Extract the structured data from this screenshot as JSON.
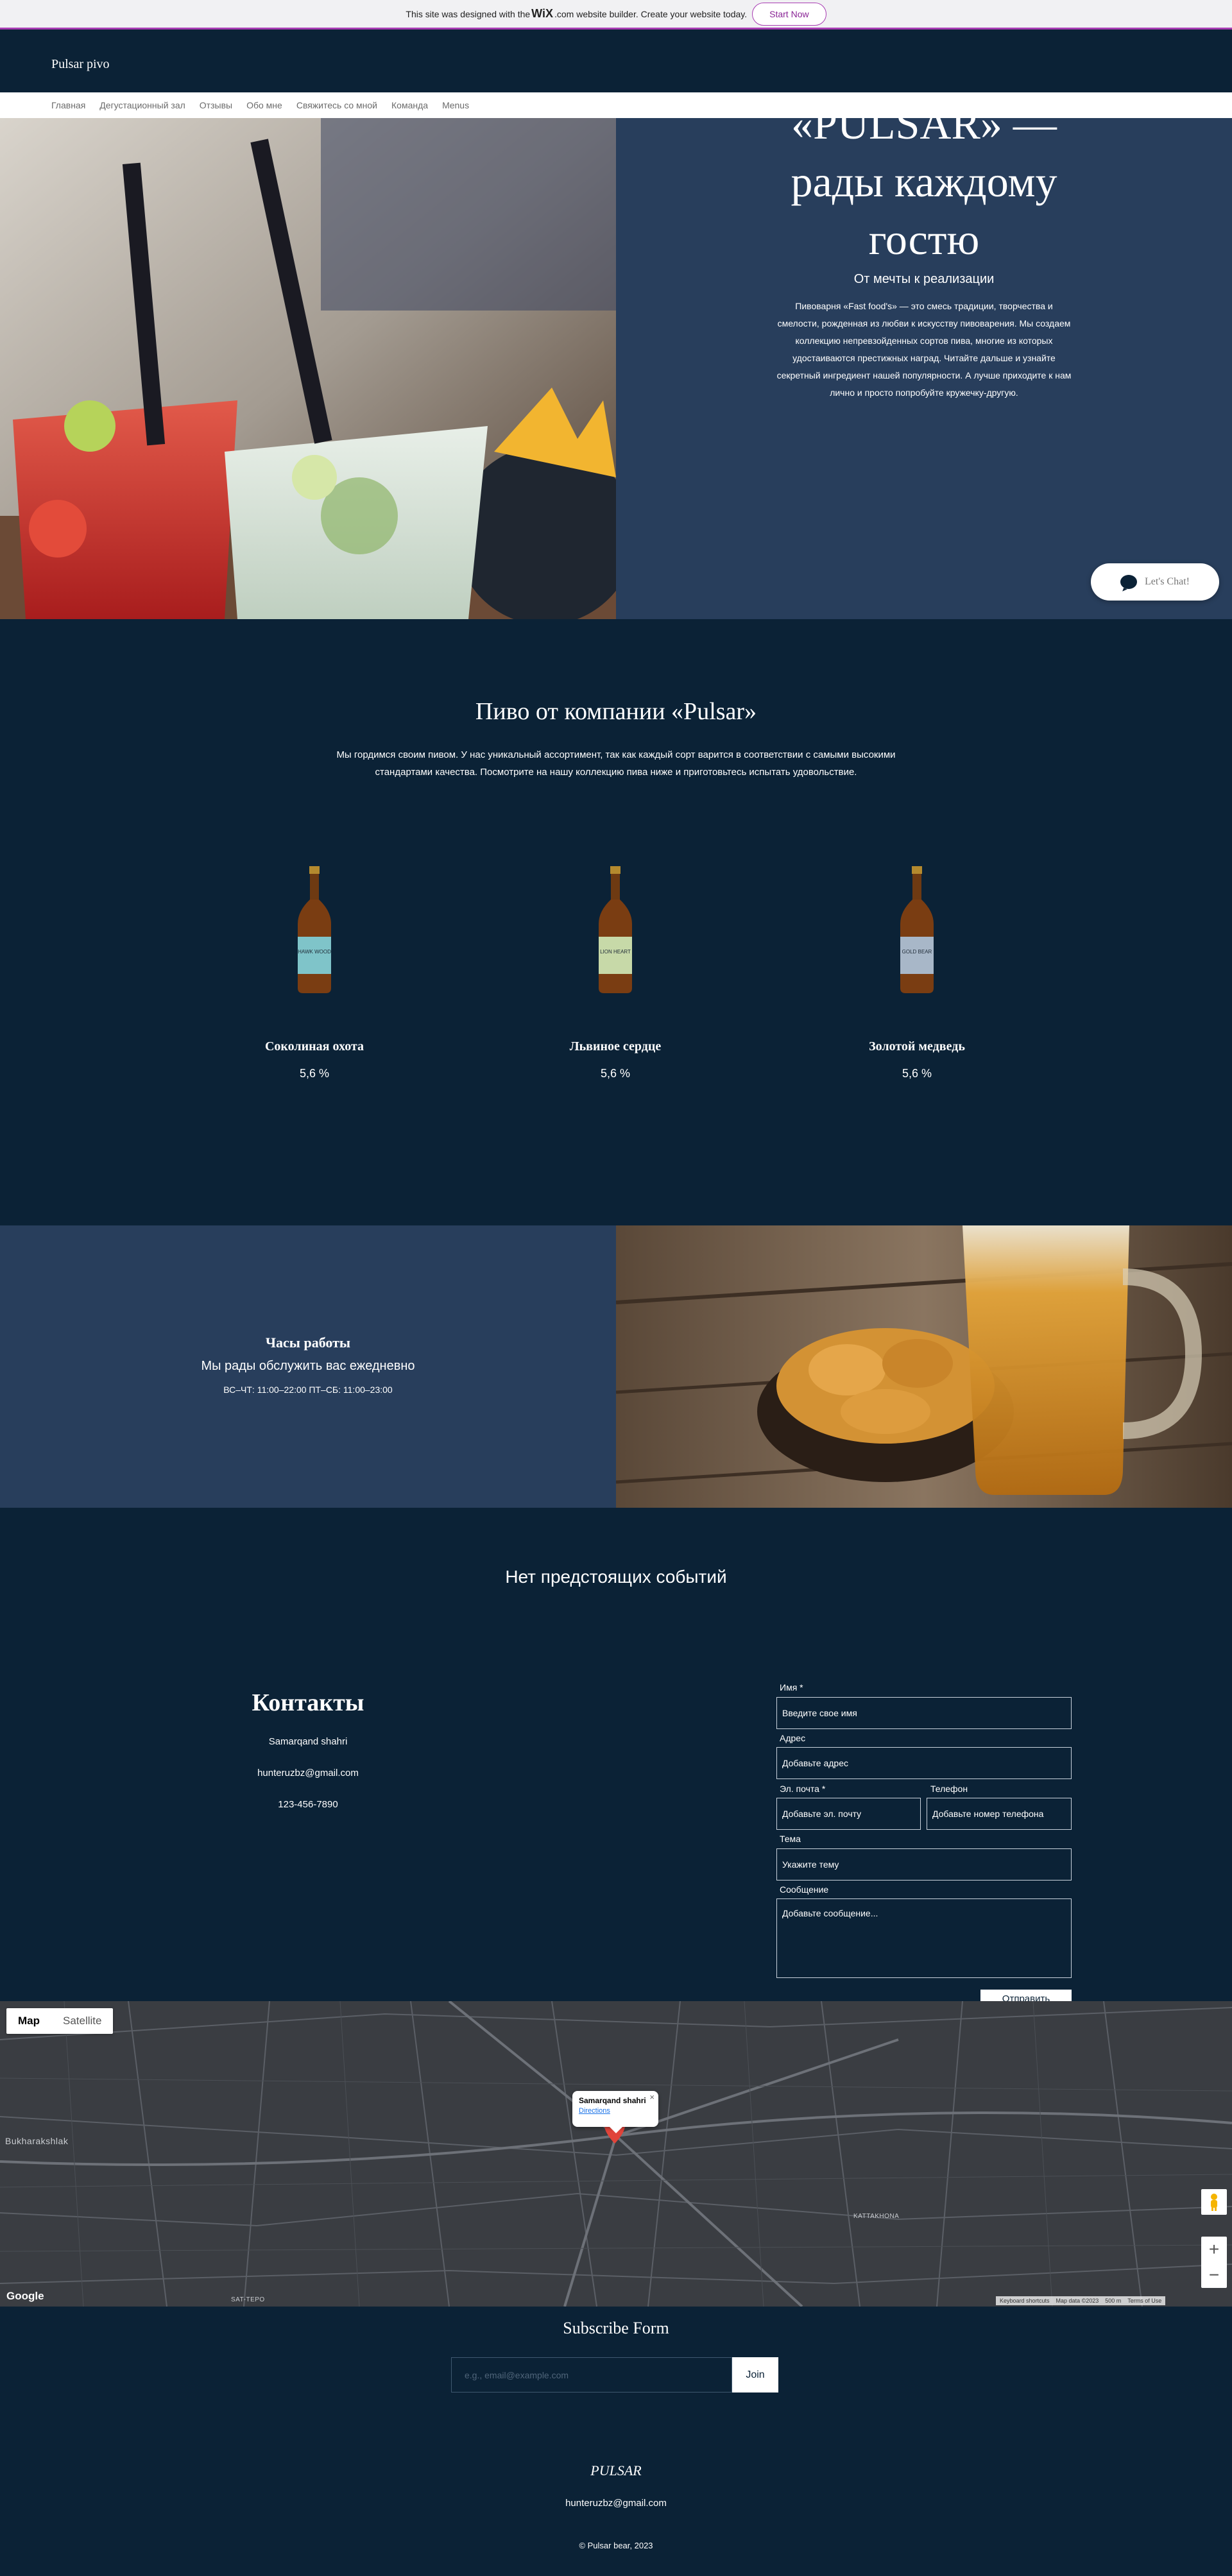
{
  "banner": {
    "text_before": "This site was designed with the",
    "logo": "WiX",
    "text_after": ".com website builder. Create your website today.",
    "start_label": "Start Now"
  },
  "header": {
    "site_title": "Pulsar pivo"
  },
  "nav": {
    "items": [
      "Главная",
      "Дегустационный зал",
      "Отзывы",
      "Обо мне",
      "Свяжитесь со мной",
      "Команда",
      "Menus"
    ]
  },
  "hero": {
    "title_line1": "«PULSAR» —",
    "title_line2": "рады каждому",
    "title_line3": "гостю",
    "subtitle": "От мечты к реализации",
    "body": "Пивоварня «Fast food's» — это смесь традиции, творчества и смелости, рожденная из любви к искусству пивоварения. Мы создаем коллекцию непревзойденных сортов пива, многие из которых удостаиваются престижных наград. Читайте дальше и узнайте секретный ингредиент нашей популярности. А лучше приходите к нам лично и просто попробуйте кружечку-другую."
  },
  "chat": {
    "label": "Let's Chat!"
  },
  "beers": {
    "title": "Пиво от компании «Pulsar»",
    "description": "Мы гордимся своим пивом. У нас уникальный ассортимент, так как каждый сорт варится в соответствии с самыми высокими стандартами качества. Посмотрите на нашу коллекцию пива ниже и приготовьтесь испытать удовольствие.",
    "items": [
      {
        "name": "Соколиная охота",
        "abv": "5,6 %",
        "label_text": "HAWK WOOD",
        "label_color": "#7fc4c9"
      },
      {
        "name": "Львиное сердце",
        "abv": "5,6 %",
        "label_text": "LION HEART",
        "label_color": "#c7d9a8"
      },
      {
        "name": "Золотой медведь",
        "abv": "5,6 %",
        "label_text": "GOLD BEAR",
        "label_color": "#a8b7c8"
      }
    ]
  },
  "hours": {
    "title": "Часы работы",
    "subtitle": "Мы рады обслужить вас ежедневно",
    "times": "ВС–ЧТ: 11:00–22:00 ПТ–СБ: 11:00–23:00"
  },
  "events": {
    "title": "Нет предстоящих событий"
  },
  "contacts": {
    "title": "Контакты",
    "address": "Samarqand shahri",
    "email": "hunteruzbz@gmail.com",
    "phone": "123-456-7890"
  },
  "form": {
    "name_label": "Имя *",
    "name_placeholder": "Введите свое имя",
    "address_label": "Адрес",
    "address_placeholder": "Добавьте адрес",
    "email_label": "Эл. почта *",
    "email_placeholder": "Добавьте эл. почту",
    "phone_label": "Телефон",
    "phone_placeholder": "Добавьте номер телефона",
    "subject_label": "Тема",
    "subject_placeholder": "Укажите тему",
    "message_label": "Сообщение",
    "message_placeholder": "Добавьте сообщение...",
    "submit_label": "Отправить"
  },
  "map": {
    "tab_map": "Map",
    "tab_satellite": "Satellite",
    "popup_name": "Samarqand shahri",
    "popup_link": "Directions",
    "google": "Google",
    "footer_items": [
      "Keyboard shortcuts",
      "Map data ©2023",
      "500 m",
      "Terms of Use"
    ],
    "labels": [
      "Bukharakshlak",
      "KATTAKHONA",
      "SAT-TEPO"
    ]
  },
  "subscribe": {
    "title": "Subscribe Form",
    "placeholder": "e.g., email@example.com",
    "join_label": "Join"
  },
  "footer": {
    "brand": "PULSAR",
    "email": "hunteruzbz@gmail.com",
    "copyright": "© Pulsar bear, 2023"
  }
}
